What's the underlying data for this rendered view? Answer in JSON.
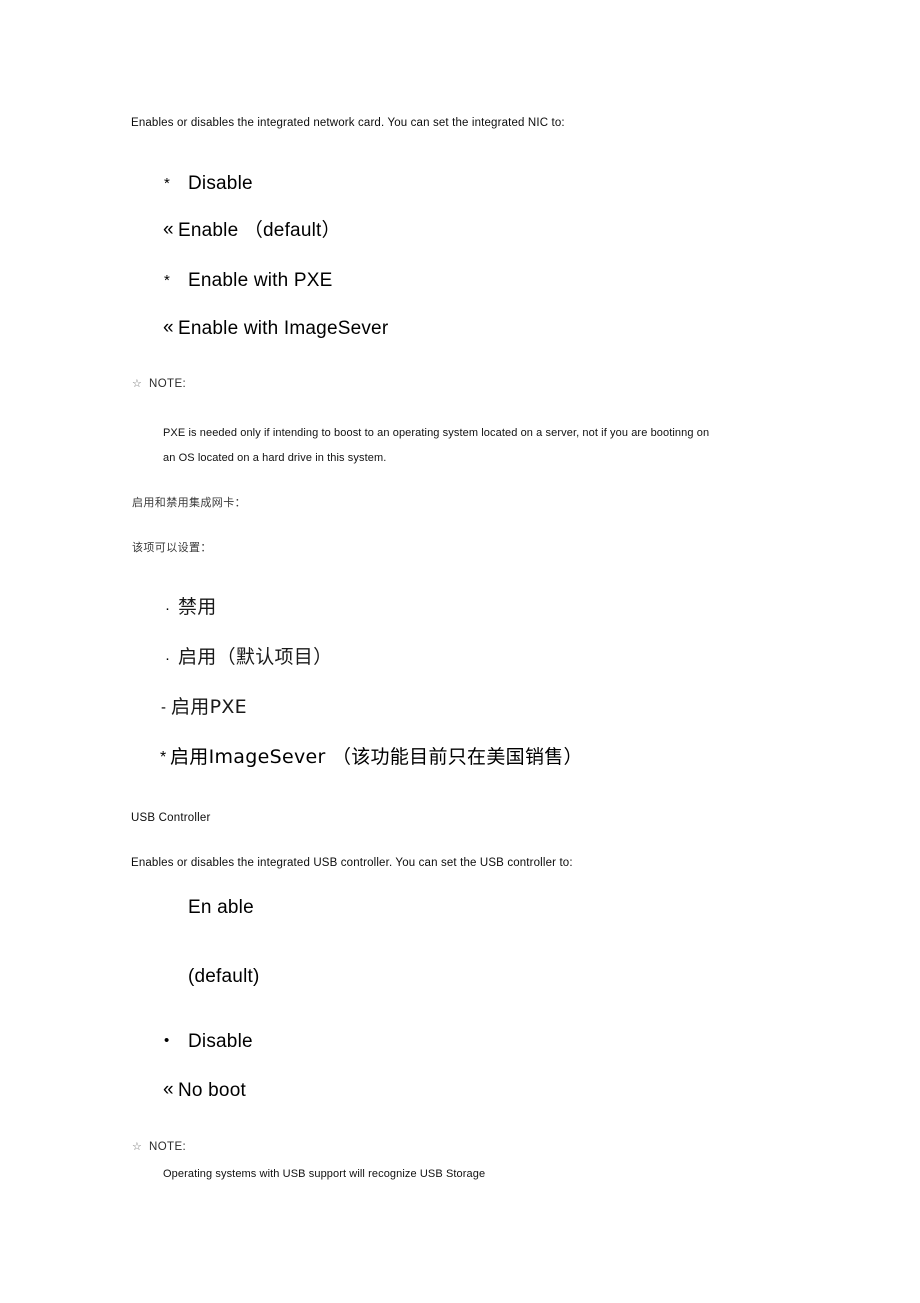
{
  "document": {
    "page_background": "#ffffff",
    "text_color": "#000000"
  },
  "nic_section": {
    "intro": "Enables or disables the integrated network card. You can set the integrated NIC to:",
    "options": [
      {
        "marker": "*",
        "label": "Disable"
      },
      {
        "marker": "«",
        "label": "Enable （default）"
      },
      {
        "marker": "*",
        "label": "Enable with PXE"
      },
      {
        "marker": "«",
        "label": "Enable with ImageSever"
      }
    ],
    "note": {
      "icon": "hollow-star-icon",
      "star_glyph": "☆",
      "title": "NOTE:",
      "lines": [
        "PXE is needed only if intending to boost to an operating system located on a server, not if you are bootinng on",
        "an OS located on a hard drive in this system."
      ]
    },
    "chinese": {
      "heading_1": "启用和禁用集成网卡：",
      "heading_2": "该项可以设置：",
      "options": [
        {
          "marker": "·",
          "label": "禁用"
        },
        {
          "marker": "·",
          "label": "启用（默认项目）"
        },
        {
          "marker": "-",
          "label": "启用PXE"
        },
        {
          "marker": "*",
          "label": "启用ImageSever （该功能目前只在美国销售）"
        }
      ]
    }
  },
  "usb_section": {
    "title": "USB Controller",
    "intro": "Enables or disables the integrated USB controller. You can set the USB controller to:",
    "options": [
      {
        "marker": "",
        "label": "En able"
      },
      {
        "marker": "",
        "label": "(default)"
      },
      {
        "marker": "•",
        "label": "Disable"
      },
      {
        "marker": "«",
        "label": "No boot"
      }
    ],
    "note": {
      "icon": "hollow-star-icon",
      "star_glyph": "☆",
      "title": "NOTE:",
      "lines": [
        "Operating systems with USB support will recognize USB Storage"
      ]
    }
  }
}
